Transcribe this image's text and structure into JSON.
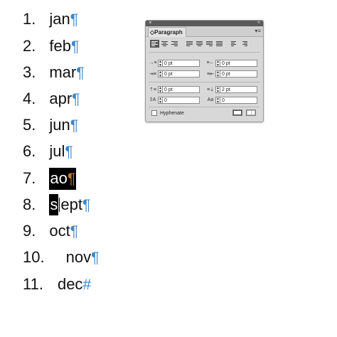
{
  "list": [
    {
      "num": "1.",
      "word": "jan",
      "mark": "¶"
    },
    {
      "num": "2.",
      "word": "feb",
      "mark": "¶"
    },
    {
      "num": "3.",
      "word": "mar",
      "mark": "¶"
    },
    {
      "num": "4.",
      "word": "apr",
      "mark": "¶"
    },
    {
      "num": "5.",
      "word": "jun",
      "mark": "¶"
    },
    {
      "num": "6.",
      "word": "jul",
      "mark": "¶"
    },
    {
      "num": "7.",
      "word": "ao",
      "mark": "¶"
    },
    {
      "num": "8.",
      "word_sel": "s",
      "word_rest": "ept",
      "mark": "¶"
    },
    {
      "num": "9.",
      "word": "oct",
      "mark": "¶"
    },
    {
      "num": "10.",
      "word": "nov",
      "mark": "¶"
    },
    {
      "num": "11.",
      "word": "dec",
      "mark": "#"
    }
  ],
  "panel": {
    "title": "Paragraph",
    "close_glyph": "×",
    "collapse_glyph": "«",
    "menu_glyph": "▾≡",
    "tab_arrow": "◇",
    "fields": {
      "left_indent": "0 pt",
      "right_indent": "0 pt",
      "first_line_indent": "0 pt",
      "last_line_indent": "0 pt",
      "space_before": "0 pt",
      "space_after": "2 pt",
      "drop_cap_lines": "0",
      "drop_cap_chars": "0"
    },
    "hyphenate_label": "Hyphenate",
    "hyphenate_checked": false
  },
  "colors": {
    "pilcrow": "#3d86c8",
    "selection": "#000000",
    "panel_bg": "#d8d8d8"
  }
}
